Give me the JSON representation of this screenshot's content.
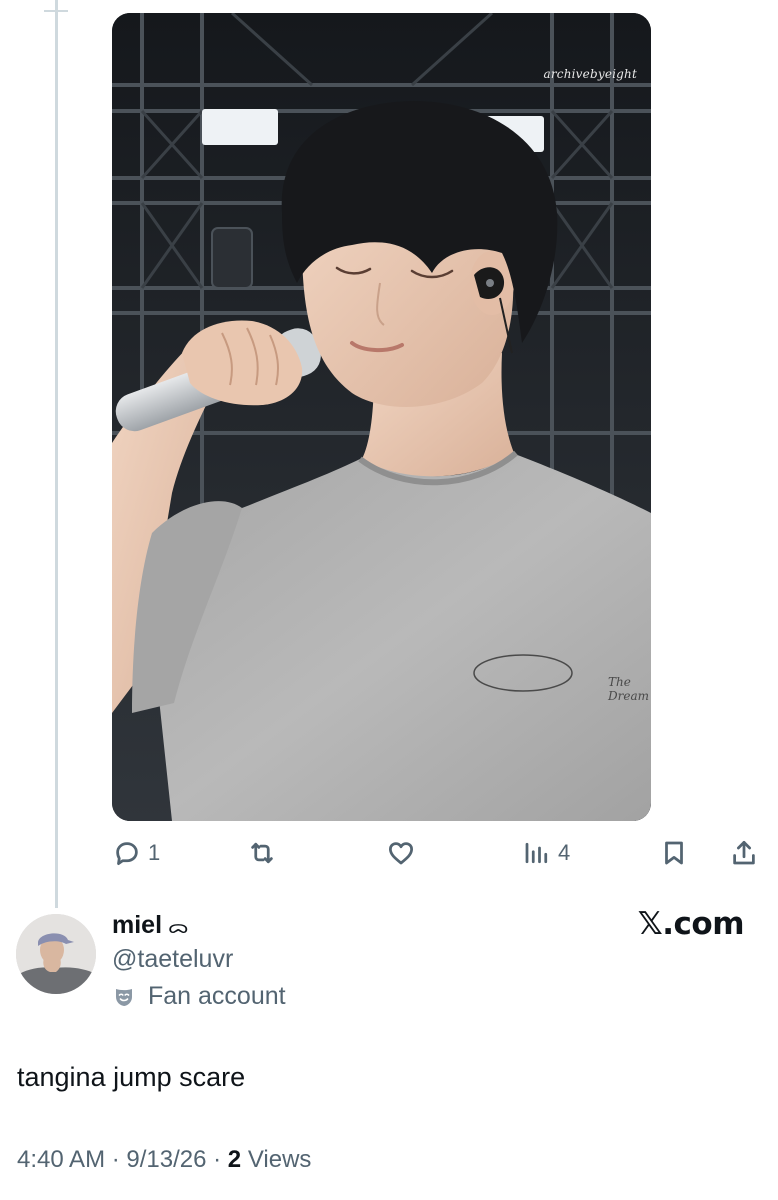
{
  "photo": {
    "watermark": "archivebyeight",
    "shirt_logo_text": "The Dream"
  },
  "actions": {
    "reply": {
      "icon": "reply-bubble-icon",
      "count": "1"
    },
    "repost": {
      "icon": "repost-icon",
      "count": ""
    },
    "like": {
      "icon": "heart-icon",
      "count": ""
    },
    "views": {
      "icon": "analytics-bars-icon",
      "count": "4"
    },
    "bookmark": {
      "icon": "bookmark-icon"
    },
    "share": {
      "icon": "share-upload-icon"
    }
  },
  "author": {
    "display_name": "miel",
    "name_decoration": "ᯅ",
    "handle": "@taeteluvr",
    "label_icon": "fan-mask-icon",
    "label": "Fan account"
  },
  "brand": "𝕏.com",
  "tweet": {
    "text": "tangina jump scare"
  },
  "meta": {
    "time": "4:40 AM",
    "sep1": " · ",
    "date": "9/13/26",
    "sep2": " · ",
    "views_count": "2",
    "views_label": " Views"
  },
  "colors": {
    "secondary_text": "#536471",
    "primary_text": "#0f1419",
    "thread_line": "#cfd9de"
  }
}
